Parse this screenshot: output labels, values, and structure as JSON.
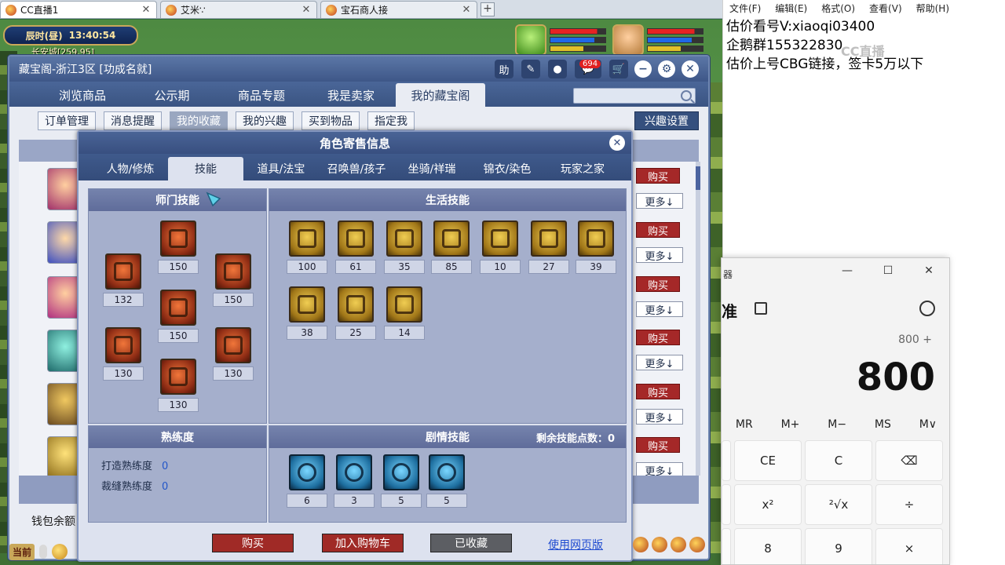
{
  "browser": {
    "tabs": [
      {
        "label": "CC直播1",
        "active": true
      },
      {
        "label": "艾米∵",
        "active": false
      },
      {
        "label": "宝石商人接",
        "active": false
      }
    ],
    "new_tab_symbol": "+"
  },
  "game_hud": {
    "clock_period": "辰时(昼)",
    "clock_time": "13:40:54",
    "location": "长安城[259,95]"
  },
  "window": {
    "title": "藏宝阁-浙江3区 [功成名就]",
    "help_label": "助",
    "notification_count": "694",
    "nav_tabs": [
      "浏览商品",
      "公示期",
      "商品专题",
      "我是卖家",
      "我的藏宝阁"
    ],
    "nav_active": 4,
    "search_placeholder": "",
    "sub_tabs": [
      "订单管理",
      "消息提醒",
      "我的收藏",
      "我的兴趣",
      "买到物品",
      "指定我"
    ],
    "sub_active": 2,
    "interest_button": "兴趣设置",
    "buy_label": "购买",
    "more_label": "更多↓",
    "wallet_label": "钱包余额"
  },
  "popup": {
    "title": "角色寄售信息",
    "tabs": [
      "人物/修炼",
      "技能",
      "道具/法宝",
      "召唤兽/孩子",
      "坐骑/祥瑞",
      "锦衣/染色",
      "玩家之家"
    ],
    "tab_active": 1,
    "school_skills_title": "师门技能",
    "school_skills": [
      "132",
      "150",
      "150",
      "150",
      "130",
      "130",
      "130"
    ],
    "life_skills_title": "生活技能",
    "life_skills": [
      "100",
      "61",
      "35",
      "85",
      "10",
      "27",
      "39",
      "38",
      "25",
      "14"
    ],
    "proficiency_title": "熟练度",
    "proficiency": [
      {
        "label": "打造熟练度",
        "value": "0"
      },
      {
        "label": "裁缝熟练度",
        "value": "0"
      }
    ],
    "story_skills_title": "剧情技能",
    "remaining_points_label": "剩余技能点数：",
    "remaining_points": "0",
    "story_skills": [
      "6",
      "3",
      "5",
      "5"
    ],
    "footer": {
      "buy": "购买",
      "add_cart": "加入购物车",
      "favorited": "已收藏",
      "web_version": "使用网页版"
    }
  },
  "game_bar": {
    "current_label": "当前"
  },
  "notepad": {
    "menu": [
      "文件(F)",
      "编辑(E)",
      "格式(O)",
      "查看(V)",
      "帮助(H)"
    ],
    "lines": [
      "估价看号V:xiaoqi03400",
      "企鹅群155322830",
      "估价上号CBG链接，签卡5万以下"
    ],
    "watermark": "CC直播"
  },
  "calculator": {
    "app_label": "器",
    "mode_label": "准",
    "minimize": "—",
    "maximize": "☐",
    "close": "✕",
    "expression": "800 +",
    "display": "800",
    "memory_keys": [
      "MR",
      "M+",
      "M−",
      "MS",
      "M∨"
    ],
    "row1": [
      "CE",
      "C",
      "⌫"
    ],
    "row2": [
      "x²",
      "²√x",
      "÷"
    ],
    "row3": [
      "8",
      "9",
      "×"
    ]
  }
}
